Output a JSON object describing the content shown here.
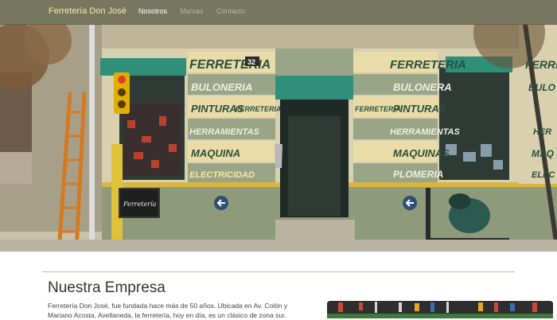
{
  "navbar": {
    "brand": "Ferretería Don José",
    "links": [
      {
        "label": "Nosotros",
        "active": true
      },
      {
        "label": "Marcas",
        "active": false
      },
      {
        "label": "Contacto",
        "active": false
      }
    ]
  },
  "hero": {
    "signs_left": [
      "FERRETERIA",
      "BULONERIA",
      "PINTURAS",
      "FERRETERIA",
      "HERRAMIENTAS",
      "MAQUINA",
      "ELECTRICIDAD"
    ],
    "signs_right": [
      "FERRETERIA",
      "BULONERA",
      "FERRETERIA",
      "PINTURAS",
      "HERRAMIENTAS",
      "MAQUINAS",
      "PLOMERIA"
    ],
    "signs_far_right": [
      "FERRETERIA",
      "BULO",
      "HER",
      "MAQ",
      "ELEC"
    ],
    "door_number": "32",
    "chalkboard": "Ferretería"
  },
  "about": {
    "title": "Nuestra Empresa",
    "paragraph": "Ferretería Don José, fue fundada hace más de 50 años. Ubicada en Av. Colón y Mariano Acosta, Avellaneda, la ferretería, hoy en día, es un clásico de zona sur."
  },
  "colors": {
    "navbar": "#77775f",
    "brand": "#f3e9a0",
    "awning": "#2f8f78",
    "wall_green": "#8e9a7a",
    "sign_cream": "#e9dca8",
    "sign_text": "#2c4f3a"
  }
}
